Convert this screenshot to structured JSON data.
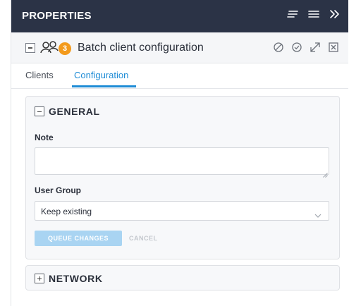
{
  "header": {
    "title": "PROPERTIES",
    "icons": [
      "sort-lines-icon",
      "menu-icon",
      "double-chevron-right-icon"
    ]
  },
  "titlebar": {
    "label": "Batch client configuration",
    "badge_count": "3",
    "actions": [
      "block-icon",
      "check-circle-icon",
      "expand-icon",
      "close-box-icon"
    ]
  },
  "tabs": [
    {
      "label": "Clients"
    },
    {
      "label": "Configuration",
      "active": true
    }
  ],
  "general": {
    "title": "GENERAL",
    "note_label": "Note",
    "note_value": "",
    "user_group_label": "User Group",
    "user_group_value": "Keep existing",
    "queue_label": "QUEUE CHANGES",
    "cancel_label": "CANCEL"
  },
  "network": {
    "title": "NETWORK"
  },
  "colors": {
    "header_bg": "#2b3346",
    "accent": "#1e8cd6",
    "badge": "#f39a1c",
    "disabled_button": "#a9d4f2"
  }
}
